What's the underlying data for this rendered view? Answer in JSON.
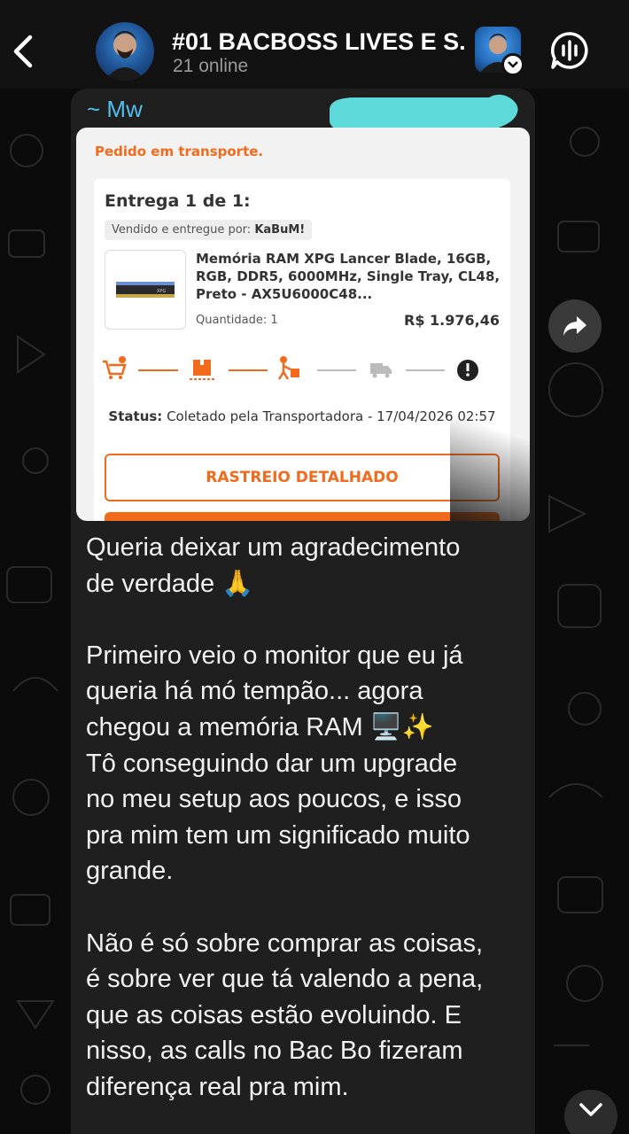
{
  "header": {
    "group_name": "#01 BACBOSS LIVES E S...",
    "subtitle": "21 online",
    "icons": {
      "back": "chevron-left-icon",
      "call": "voice-chat-icon",
      "verified": "chevron-down-icon"
    }
  },
  "message": {
    "sender": "~ Mw",
    "embedded_screenshot": {
      "order_status": "Pedido em transporte.",
      "delivery_title": "Entrega 1 de 1:",
      "seller_label": "Vendido e entregue por:",
      "seller_name": "KaBuM!",
      "product_name": "Memória RAM XPG Lancer Blade, 16GB, RGB, DDR5, 6000MHz, Single Tray, CL48, Preto  - AX5U6000C48...",
      "quantity": "Quantidade: 1",
      "price": "R$  1.976,46",
      "tracking_steps": [
        "cart-check-icon",
        "package-icon",
        "delivery-person-icon",
        "truck-icon",
        "alert-icon"
      ],
      "status_label": "Status:",
      "status_text": "Coletado pela Transportadora - 17/04/2026 02:57",
      "track_button": "RASTREIO DETALHADO"
    },
    "text": "Queria deixar um agradecimento\nde verdade 🙏\n\nPrimeiro veio o monitor que eu já\nqueria há mó tempão... agora\nchegou a memória RAM 🖥️✨\nTô conseguindo dar um upgrade\nno meu setup aos poucos, e isso\npra mim tem um significado muito\ngrande.\n\nNão é só sobre comprar as coisas,\né sobre ver que tá valendo a pena,\nque as coisas estão evoluindo. E\nnisso, as calls no Bac Bo fizeram\ndiferença real pra mim."
  },
  "colors": {
    "sender": "#53bdeb",
    "accent_orange": "#f26a1b",
    "bubble": "#1f1f1f",
    "redaction": "#5ed9d9"
  }
}
